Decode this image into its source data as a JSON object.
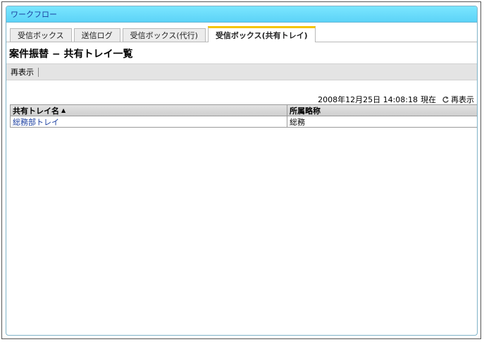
{
  "window": {
    "title": "ワークフロー"
  },
  "tabs": [
    {
      "label": "受信ボックス",
      "active": false
    },
    {
      "label": "送信ログ",
      "active": false
    },
    {
      "label": "受信ボックス(代行)",
      "active": false
    },
    {
      "label": "受信ボックス(共有トレイ)",
      "active": true
    }
  ],
  "page": {
    "title": "案件振替 − 共有トレイ一覧"
  },
  "toolbar": {
    "redisplay_label": "再表示"
  },
  "status": {
    "timestamp": "2008年12月25日 14:08:18",
    "current_label": "現在",
    "refresh_label": "再表示",
    "refresh_icon": "refresh-icon"
  },
  "table": {
    "columns": [
      {
        "label": "共有トレイ名",
        "sort": "ascending"
      },
      {
        "label": "所属略称"
      }
    ],
    "rows": [
      {
        "tray_name": "総務部トレイ",
        "affiliation": "総務"
      }
    ]
  },
  "colors": {
    "titlebar": "#5cd3f7",
    "active_tab_accent": "#f5c400",
    "link": "#1a3ea0"
  }
}
